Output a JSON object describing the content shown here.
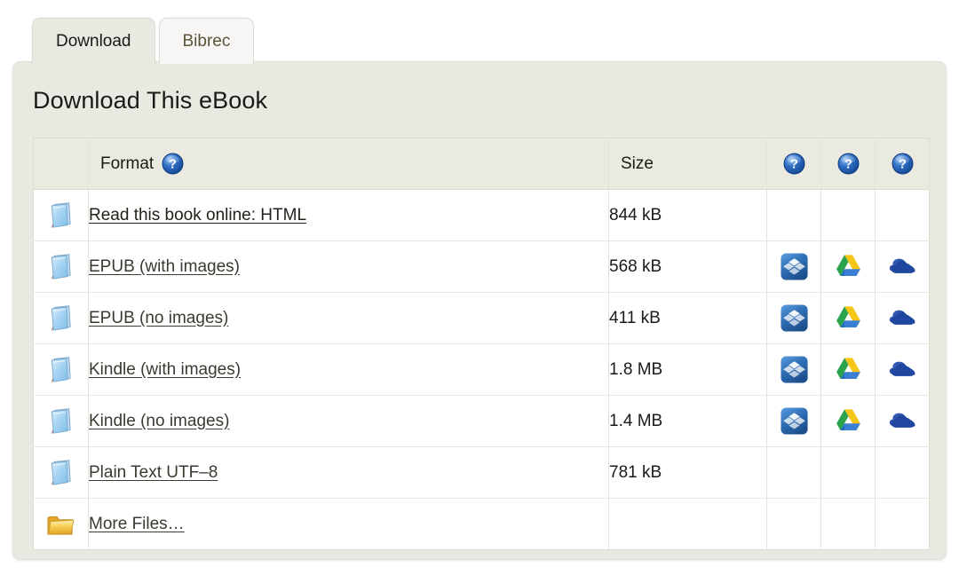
{
  "tabs": [
    {
      "label": "Download",
      "state": "active"
    },
    {
      "label": "Bibrec",
      "state": "inactive"
    }
  ],
  "page": {
    "title": "Download This eBook"
  },
  "table": {
    "headers": {
      "icon_col": "",
      "format": "Format",
      "format_help_icon": "help-icon",
      "size": "Size",
      "dropbox_help_icon": "help-icon",
      "gdrive_help_icon": "help-icon",
      "onedrive_help_icon": "help-icon"
    },
    "rows": [
      {
        "icon": "book-icon",
        "format": "Read this book online: HTML",
        "size": "844 kB",
        "dropbox": "",
        "gdrive": "",
        "onedrive": ""
      },
      {
        "icon": "book-icon",
        "format": "EPUB (with images)",
        "size": "568 kB",
        "dropbox": "dropbox-icon",
        "gdrive": "google-drive-icon",
        "onedrive": "onedrive-icon"
      },
      {
        "icon": "book-icon",
        "format": "EPUB (no images)",
        "size": "411 kB",
        "dropbox": "dropbox-icon",
        "gdrive": "google-drive-icon",
        "onedrive": "onedrive-icon"
      },
      {
        "icon": "book-icon",
        "format": "Kindle (with images)",
        "size": "1.8 MB",
        "dropbox": "dropbox-icon",
        "gdrive": "google-drive-icon",
        "onedrive": "onedrive-icon"
      },
      {
        "icon": "book-icon",
        "format": "Kindle (no images)",
        "size": "1.4 MB",
        "dropbox": "dropbox-icon",
        "gdrive": "google-drive-icon",
        "onedrive": "onedrive-icon"
      },
      {
        "icon": "book-icon",
        "format": "Plain Text UTF–8",
        "size": "781 kB",
        "dropbox": "",
        "gdrive": "",
        "onedrive": ""
      },
      {
        "icon": "folder-icon",
        "format": "More Files…",
        "size": "",
        "dropbox": "",
        "gdrive": "",
        "onedrive": ""
      }
    ]
  },
  "colors": {
    "panel_bg": "#e8e9e0",
    "tab_active_bg": "#e8e9e0",
    "tab_inactive_bg": "#f7f6f4",
    "table_header_bg": "#eaeae1",
    "help_blue": "#1f5fbf",
    "dropbox_blue": "#2b6fb5",
    "gdrive_green": "#2aa05a",
    "gdrive_yellow": "#f6c залив00",
    "gdrive_blue": "#3b7fd4",
    "onedrive_blue": "#1f4fa8",
    "folder_gold": "#f2c14a",
    "book_blue": "#a8d3f0"
  }
}
